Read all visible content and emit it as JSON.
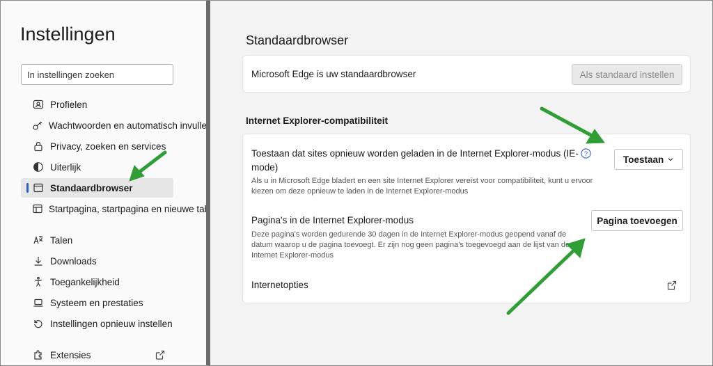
{
  "sidebar": {
    "title": "Instellingen",
    "search_placeholder": "In instellingen zoeken",
    "items": [
      {
        "label": "Profielen",
        "icon": "profile-icon"
      },
      {
        "label": "Wachtwoorden en automatisch invullen",
        "icon": "key-icon"
      },
      {
        "label": "Privacy, zoeken en services",
        "icon": "lock-icon"
      },
      {
        "label": "Uiterlijk",
        "icon": "appearance-icon"
      },
      {
        "label": "Standaardbrowser",
        "icon": "browser-icon",
        "active": true
      },
      {
        "label": "Startpagina, startpagina en nieuwe tabbladen",
        "icon": "home-icon"
      },
      {
        "label": "Talen",
        "icon": "language-icon"
      },
      {
        "label": "Downloads",
        "icon": "download-icon"
      },
      {
        "label": "Toegankelijkheid",
        "icon": "accessibility-icon"
      },
      {
        "label": "Systeem en prestaties",
        "icon": "laptop-icon"
      },
      {
        "label": "Instellingen opnieuw instellen",
        "icon": "reset-icon"
      },
      {
        "label": "Extensies",
        "icon": "extensions-icon"
      }
    ]
  },
  "main": {
    "title": "Standaardbrowser",
    "default_card": {
      "text": "Microsoft Edge is uw standaardbrowser",
      "button": "Als standaard instellen"
    },
    "ie_section": {
      "heading": "Internet Explorer-compatibiliteit",
      "reload_title": "Toestaan dat sites opnieuw worden geladen in de Internet Explorer-modus (IE-mode)",
      "reload_desc": "Als u in Microsoft Edge bladert en een site Internet Explorer vereist voor compatibiliteit, kunt u ervoor kiezen om deze opnieuw te laden in de Internet Explorer-modus",
      "reload_value": "Toestaan",
      "pages_title": "Pagina's in de Internet Explorer-modus",
      "pages_desc": "Deze pagina's worden gedurende 30 dagen in de Internet Explorer-modus geopend vanaf de datum waarop u de pagina toevoegt. Er zijn nog geen pagina's toegevoegd aan de lijst van de Internet Explorer-modus",
      "add_button": "Pagina toevoegen",
      "options_label": "Internetopties"
    }
  },
  "colors": {
    "accent": "#2a61d4",
    "arrow": "#2e9e35"
  }
}
